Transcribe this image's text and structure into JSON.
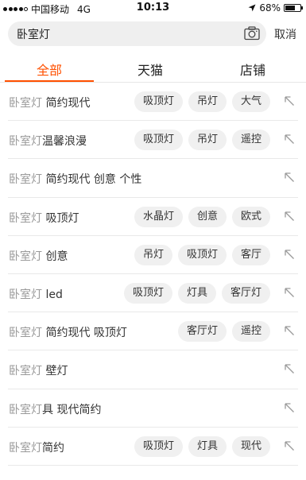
{
  "status_bar": {
    "carrier": "中国移动",
    "network": "4G",
    "time": "10:13",
    "battery_percent": "68%",
    "battery_level": 0.68,
    "icons": [
      "signal-dots-icon",
      "location-arrow-icon",
      "battery-icon"
    ]
  },
  "search": {
    "query": "卧室灯",
    "camera_icon": "camera-icon",
    "cancel_label": "取消"
  },
  "tabs": [
    {
      "label": "全部",
      "active": true
    },
    {
      "label": "天猫",
      "active": false
    },
    {
      "label": "店铺",
      "active": false
    }
  ],
  "accent_color": "#ff5000",
  "suggestions": [
    {
      "prefix": "卧室灯",
      "rest": " 简约现代",
      "tags": [
        "吸顶灯",
        "吊灯",
        "大气"
      ]
    },
    {
      "prefix": "卧室灯",
      "rest": "温馨浪漫",
      "tags": [
        "吸顶灯",
        "吊灯",
        "遥控"
      ]
    },
    {
      "prefix": "卧室灯",
      "rest": " 简约现代 创意 个性",
      "tags": []
    },
    {
      "prefix": "卧室灯",
      "rest": " 吸顶灯",
      "tags": [
        "水晶灯",
        "创意",
        "欧式"
      ]
    },
    {
      "prefix": "卧室灯",
      "rest": " 创意",
      "tags": [
        "吊灯",
        "吸顶灯",
        "客厅"
      ]
    },
    {
      "prefix": "卧室灯",
      "rest": " led",
      "tags": [
        "吸顶灯",
        "灯具",
        "客厅灯"
      ]
    },
    {
      "prefix": "卧室灯",
      "rest": " 简约现代 吸顶灯",
      "tags": [
        "客厅灯",
        "遥控"
      ]
    },
    {
      "prefix": "卧室灯",
      "rest": " 壁灯",
      "tags": []
    },
    {
      "prefix": "卧室灯",
      "rest": "具 现代简约",
      "tags": []
    },
    {
      "prefix": "卧室灯",
      "rest": "简约",
      "tags": [
        "吸顶灯",
        "灯具",
        "现代"
      ]
    }
  ]
}
